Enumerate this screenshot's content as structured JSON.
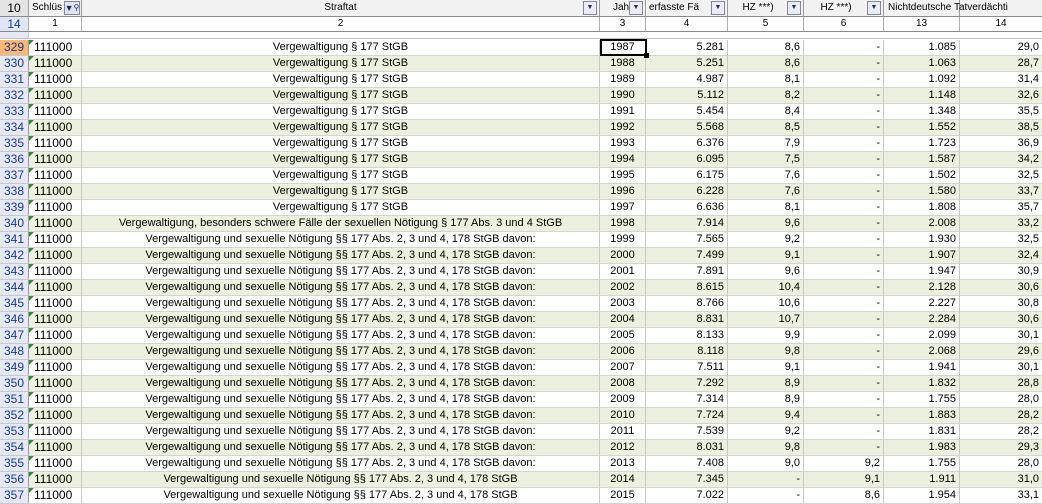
{
  "header": {
    "corner": "10",
    "columns": [
      {
        "label": "Schlüs",
        "filter_active": true
      },
      {
        "label": "Straftat",
        "filter_active": false
      },
      {
        "label": "Jah",
        "filter_active": false
      },
      {
        "label": "erfasste Fä",
        "filter_active": false
      },
      {
        "label": "HZ ***)",
        "filter_active": false
      },
      {
        "label": "HZ ***)",
        "filter_active": false
      },
      {
        "label": "Nichtdeutsche Tatverdächti",
        "filter_active": false
      },
      {
        "label": "",
        "filter_active": false
      }
    ]
  },
  "numbering": {
    "corner": "14",
    "values": [
      "1",
      "2",
      "3",
      "4",
      "5",
      "6",
      "13",
      "14"
    ]
  },
  "selected_row": "329",
  "rows": [
    {
      "rn": "329",
      "code": "111000",
      "desc": "Vergewaltigung § 177 StGB",
      "year": "1987",
      "cases": "5.281",
      "hz": "8,6",
      "hz2": "-",
      "nd": "1.085",
      "pct": "29,0"
    },
    {
      "rn": "330",
      "code": "111000",
      "desc": "Vergewaltigung § 177 StGB",
      "year": "1988",
      "cases": "5.251",
      "hz": "8,6",
      "hz2": "-",
      "nd": "1.063",
      "pct": "28,7"
    },
    {
      "rn": "331",
      "code": "111000",
      "desc": "Vergewaltigung § 177 StGB",
      "year": "1989",
      "cases": "4.987",
      "hz": "8,1",
      "hz2": "-",
      "nd": "1.092",
      "pct": "31,4"
    },
    {
      "rn": "332",
      "code": "111000",
      "desc": "Vergewaltigung § 177 StGB",
      "year": "1990",
      "cases": "5.112",
      "hz": "8,2",
      "hz2": "-",
      "nd": "1.148",
      "pct": "32,6"
    },
    {
      "rn": "333",
      "code": "111000",
      "desc": "Vergewaltigung § 177 StGB",
      "year": "1991",
      "cases": "5.454",
      "hz": "8,4",
      "hz2": "-",
      "nd": "1.348",
      "pct": "35,5"
    },
    {
      "rn": "334",
      "code": "111000",
      "desc": "Vergewaltigung § 177 StGB",
      "year": "1992",
      "cases": "5.568",
      "hz": "8,5",
      "hz2": "-",
      "nd": "1.552",
      "pct": "38,5"
    },
    {
      "rn": "335",
      "code": "111000",
      "desc": "Vergewaltigung § 177 StGB",
      "year": "1993",
      "cases": "6.376",
      "hz": "7,9",
      "hz2": "-",
      "nd": "1.723",
      "pct": "36,9"
    },
    {
      "rn": "336",
      "code": "111000",
      "desc": "Vergewaltigung § 177 StGB",
      "year": "1994",
      "cases": "6.095",
      "hz": "7,5",
      "hz2": "-",
      "nd": "1.587",
      "pct": "34,2"
    },
    {
      "rn": "337",
      "code": "111000",
      "desc": "Vergewaltigung § 177 StGB",
      "year": "1995",
      "cases": "6.175",
      "hz": "7,6",
      "hz2": "-",
      "nd": "1.502",
      "pct": "32,5"
    },
    {
      "rn": "338",
      "code": "111000",
      "desc": "Vergewaltigung § 177 StGB",
      "year": "1996",
      "cases": "6.228",
      "hz": "7,6",
      "hz2": "-",
      "nd": "1.580",
      "pct": "33,7"
    },
    {
      "rn": "339",
      "code": "111000",
      "desc": "Vergewaltigung § 177 StGB",
      "year": "1997",
      "cases": "6.636",
      "hz": "8,1",
      "hz2": "-",
      "nd": "1.808",
      "pct": "35,7"
    },
    {
      "rn": "340",
      "code": "111000",
      "desc": "Vergewaltigung, besonders schwere Fälle der sexuellen Nötigung § 177 Abs. 3 und 4 StGB",
      "year": "1998",
      "cases": "7.914",
      "hz": "9,6",
      "hz2": "-",
      "nd": "2.008",
      "pct": "33,2"
    },
    {
      "rn": "341",
      "code": "111000",
      "desc": "Vergewaltigung und sexuelle Nötigung §§ 177 Abs. 2, 3 und 4, 178 StGB davon:",
      "year": "1999",
      "cases": "7.565",
      "hz": "9,2",
      "hz2": "-",
      "nd": "1.930",
      "pct": "32,5"
    },
    {
      "rn": "342",
      "code": "111000",
      "desc": "Vergewaltigung und sexuelle Nötigung §§ 177 Abs. 2, 3 und 4, 178 StGB davon:",
      "year": "2000",
      "cases": "7.499",
      "hz": "9,1",
      "hz2": "-",
      "nd": "1.907",
      "pct": "32,4"
    },
    {
      "rn": "343",
      "code": "111000",
      "desc": "Vergewaltigung und sexuelle Nötigung §§ 177 Abs. 2, 3 und 4, 178 StGB davon:",
      "year": "2001",
      "cases": "7.891",
      "hz": "9,6",
      "hz2": "-",
      "nd": "1.947",
      "pct": "30,9"
    },
    {
      "rn": "344",
      "code": "111000",
      "desc": "Vergewaltigung und sexuelle Nötigung §§ 177 Abs. 2, 3 und 4, 178 StGB davon:",
      "year": "2002",
      "cases": "8.615",
      "hz": "10,4",
      "hz2": "-",
      "nd": "2.128",
      "pct": "30,6"
    },
    {
      "rn": "345",
      "code": "111000",
      "desc": "Vergewaltigung und sexuelle Nötigung §§ 177 Abs. 2, 3 und 4, 178 StGB davon:",
      "year": "2003",
      "cases": "8.766",
      "hz": "10,6",
      "hz2": "-",
      "nd": "2.227",
      "pct": "30,8"
    },
    {
      "rn": "346",
      "code": "111000",
      "desc": "Vergewaltigung und sexuelle Nötigung §§ 177 Abs. 2, 3 und 4, 178 StGB davon:",
      "year": "2004",
      "cases": "8.831",
      "hz": "10,7",
      "hz2": "-",
      "nd": "2.284",
      "pct": "30,6"
    },
    {
      "rn": "347",
      "code": "111000",
      "desc": "Vergewaltigung und sexuelle Nötigung §§ 177 Abs. 2, 3 und 4, 178 StGB davon:",
      "year": "2005",
      "cases": "8.133",
      "hz": "9,9",
      "hz2": "-",
      "nd": "2.099",
      "pct": "30,1"
    },
    {
      "rn": "348",
      "code": "111000",
      "desc": "Vergewaltigung und sexuelle Nötigung §§ 177 Abs. 2, 3 und 4, 178 StGB davon:",
      "year": "2006",
      "cases": "8.118",
      "hz": "9,8",
      "hz2": "-",
      "nd": "2.068",
      "pct": "29,6"
    },
    {
      "rn": "349",
      "code": "111000",
      "desc": "Vergewaltigung und sexuelle Nötigung §§ 177 Abs. 2, 3 und 4, 178 StGB davon:",
      "year": "2007",
      "cases": "7.511",
      "hz": "9,1",
      "hz2": "-",
      "nd": "1.941",
      "pct": "30,1"
    },
    {
      "rn": "350",
      "code": "111000",
      "desc": "Vergewaltigung und sexuelle Nötigung §§ 177 Abs. 2, 3 und 4, 178 StGB davon:",
      "year": "2008",
      "cases": "7.292",
      "hz": "8,9",
      "hz2": "-",
      "nd": "1.832",
      "pct": "28,8"
    },
    {
      "rn": "351",
      "code": "111000",
      "desc": "Vergewaltigung und sexuelle Nötigung §§ 177 Abs. 2, 3 und 4, 178 StGB davon:",
      "year": "2009",
      "cases": "7.314",
      "hz": "8,9",
      "hz2": "-",
      "nd": "1.755",
      "pct": "28,0"
    },
    {
      "rn": "352",
      "code": "111000",
      "desc": "Vergewaltigung und sexuelle Nötigung §§ 177 Abs. 2, 3 und 4, 178 StGB davon:",
      "year": "2010",
      "cases": "7.724",
      "hz": "9,4",
      "hz2": "-",
      "nd": "1.883",
      "pct": "28,2"
    },
    {
      "rn": "353",
      "code": "111000",
      "desc": "Vergewaltigung und sexuelle Nötigung §§ 177 Abs. 2, 3 und 4, 178 StGB davon:",
      "year": "2011",
      "cases": "7.539",
      "hz": "9,2",
      "hz2": "-",
      "nd": "1.831",
      "pct": "28,2"
    },
    {
      "rn": "354",
      "code": "111000",
      "desc": "Vergewaltigung und sexuelle Nötigung §§ 177 Abs. 2, 3 und 4, 178 StGB davon:",
      "year": "2012",
      "cases": "8.031",
      "hz": "9,8",
      "hz2": "-",
      "nd": "1.983",
      "pct": "29,3"
    },
    {
      "rn": "355",
      "code": "111000",
      "desc": "Vergewaltigung und sexuelle Nötigung §§ 177 Abs. 2, 3 und 4, 178 StGB davon:",
      "year": "2013",
      "cases": "7.408",
      "hz": "9,0",
      "hz2": "9,2",
      "nd": "1.755",
      "pct": "28,0"
    },
    {
      "rn": "356",
      "code": "111000",
      "desc": "Vergewaltigung und sexuelle Nötigung §§ 177 Abs. 2, 3 und 4, 178 StGB",
      "year": "2014",
      "cases": "7.345",
      "hz": "-",
      "hz2": "9,1",
      "nd": "1.911",
      "pct": "31,0"
    },
    {
      "rn": "357",
      "code": "111000",
      "desc": "Vergewaltigung und sexuelle Nötigung §§ 177 Abs. 2, 3 und 4, 178 StGB",
      "year": "2015",
      "cases": "7.022",
      "hz": "-",
      "hz2": "8,6",
      "nd": "1.954",
      "pct": "33,1"
    }
  ]
}
